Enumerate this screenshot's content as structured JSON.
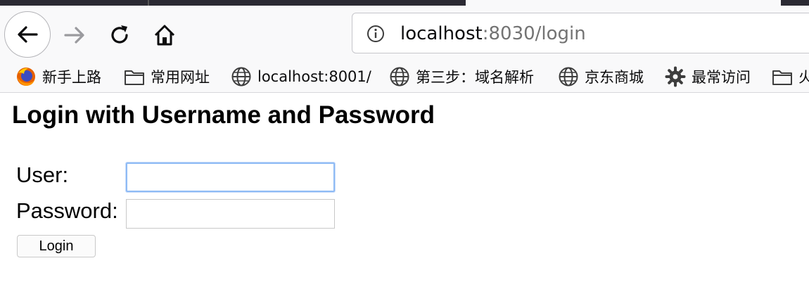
{
  "browser": {
    "url_host": "localhost",
    "url_path": ":8030/login",
    "bookmarks": [
      {
        "label": "新手上路",
        "icon": "firefox-icon"
      },
      {
        "label": "常用网址",
        "icon": "folder-icon"
      },
      {
        "label": "localhost:8001/",
        "icon": "globe-icon"
      },
      {
        "label": "第三步：域名解析",
        "icon": "globe-icon"
      },
      {
        "label": "京东商城",
        "icon": "globe-icon"
      },
      {
        "label": "最常访问",
        "icon": "gear-icon"
      },
      {
        "label": "火",
        "icon": "folder-icon"
      }
    ]
  },
  "page": {
    "title": "Login with Username and Password",
    "user_label": "User:",
    "user_value": "",
    "password_label": "Password:",
    "password_value": "",
    "login_button": "Login"
  },
  "colors": {
    "focus_ring": "#8fbbf5",
    "toolbar_bg": "#f9f9fa"
  }
}
